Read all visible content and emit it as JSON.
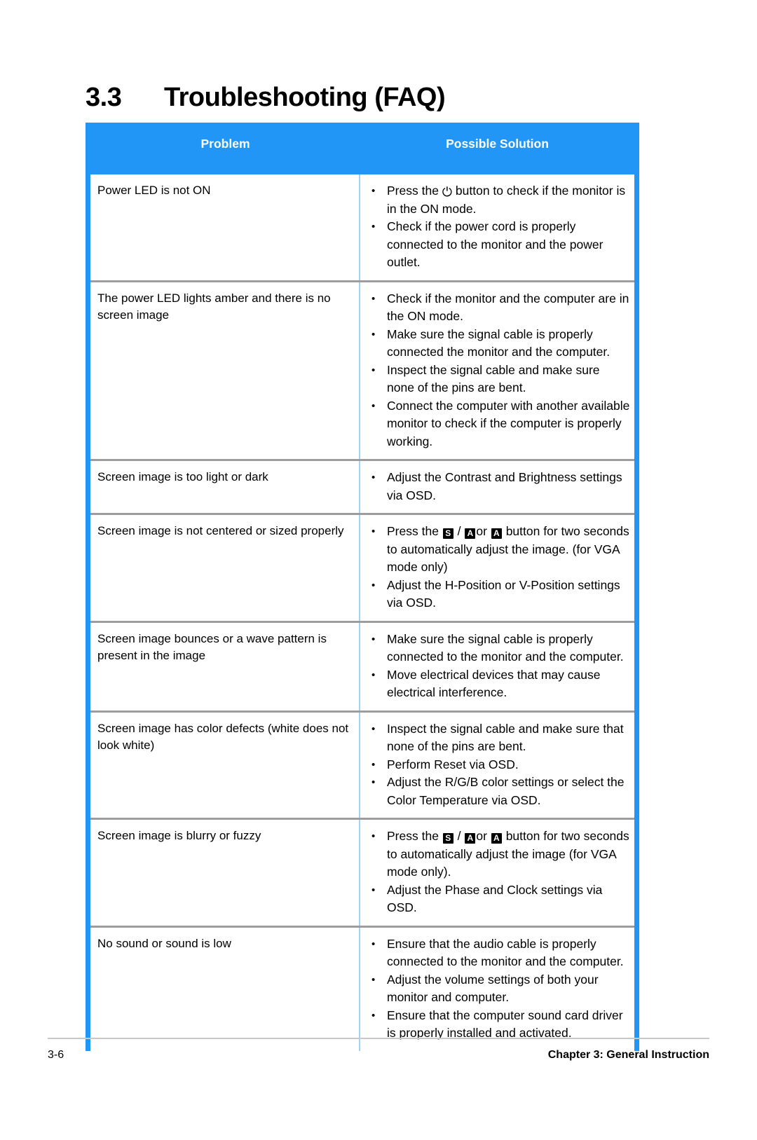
{
  "heading": {
    "number": "3.3",
    "title": "Troubleshooting (FAQ)"
  },
  "table": {
    "columns": {
      "problem": "Problem",
      "solution": "Possible Solution"
    },
    "rows": [
      {
        "problem": "Power  LED is not ON",
        "solutions": [
          {
            "parts": [
              {
                "type": "text",
                "value": "Press the "
              },
              {
                "type": "icon",
                "icon": "power-icon",
                "glyph": "⏻"
              },
              {
                "type": "text",
                "value": " button to check if the monitor is in the ON mode."
              }
            ]
          },
          {
            "parts": [
              {
                "type": "text",
                "value": "Check if the power cord is properly connected to the monitor and the power outlet."
              }
            ]
          }
        ]
      },
      {
        "problem": "The power LED lights amber and there is no screen image",
        "solutions": [
          {
            "parts": [
              {
                "type": "text",
                "value": "Check if the monitor and the computer are in the ON mode."
              }
            ]
          },
          {
            "parts": [
              {
                "type": "text",
                "value": "Make sure the signal cable is properly connected the monitor and the computer."
              }
            ]
          },
          {
            "parts": [
              {
                "type": "text",
                "value": "Inspect the signal cable and make sure none of the pins are bent."
              }
            ]
          },
          {
            "parts": [
              {
                "type": "text",
                "value": "Connect the computer with another available monitor to check if the computer is properly working."
              }
            ]
          }
        ]
      },
      {
        "problem": "Screen image is too light or dark",
        "solutions": [
          {
            "parts": [
              {
                "type": "text",
                "value": "Adjust the Contrast and Brightness settings via OSD."
              }
            ]
          }
        ]
      },
      {
        "problem": "Screen image is not centered or sized properly",
        "solutions": [
          {
            "parts": [
              {
                "type": "text",
                "value": "Press the "
              },
              {
                "type": "icon",
                "icon": "source-key-icon",
                "glyph": "S"
              },
              {
                "type": "text",
                "value": " / "
              },
              {
                "type": "icon",
                "icon": "auto-key-icon",
                "glyph": "A"
              },
              {
                "type": "text",
                "value": "or "
              },
              {
                "type": "icon",
                "icon": "auto-key-icon",
                "glyph": "A"
              },
              {
                "type": "text",
                "value": " button for two seconds to automatically adjust the image. (for VGA mode only)"
              }
            ]
          },
          {
            "parts": [
              {
                "type": "text",
                "value": "Adjust the H-Position or V-Position settings via OSD."
              }
            ]
          }
        ]
      },
      {
        "problem": "Screen image bounces or a wave pattern is present in the image",
        "solutions": [
          {
            "parts": [
              {
                "type": "text",
                "value": "Make sure the signal cable is properly connected to the monitor and the computer."
              }
            ]
          },
          {
            "parts": [
              {
                "type": "text",
                "value": "Move electrical devices that may cause electrical interference."
              }
            ]
          }
        ]
      },
      {
        "problem": "Screen image has color defects (white does not look white)",
        "solutions": [
          {
            "parts": [
              {
                "type": "text",
                "value": "Inspect the signal cable and make sure that none of the pins are bent."
              }
            ]
          },
          {
            "parts": [
              {
                "type": "text",
                "value": "Perform Reset via OSD."
              }
            ]
          },
          {
            "parts": [
              {
                "type": "text",
                "value": "Adjust the R/G/B color settings or select the Color Temperature via OSD."
              }
            ]
          }
        ]
      },
      {
        "problem": "Screen image is blurry or fuzzy",
        "solutions": [
          {
            "parts": [
              {
                "type": "text",
                "value": "Press the "
              },
              {
                "type": "icon",
                "icon": "source-key-icon",
                "glyph": "S"
              },
              {
                "type": "text",
                "value": " / "
              },
              {
                "type": "icon",
                "icon": "auto-key-icon",
                "glyph": "A"
              },
              {
                "type": "text",
                "value": "or "
              },
              {
                "type": "icon",
                "icon": "auto-key-icon",
                "glyph": "A"
              },
              {
                "type": "text",
                "value": " button for two seconds to automatically adjust the image (for VGA mode only)."
              }
            ]
          },
          {
            "parts": [
              {
                "type": "text",
                "value": "Adjust the Phase and Clock settings via OSD."
              }
            ]
          }
        ]
      },
      {
        "problem": "No sound or sound is low",
        "solutions": [
          {
            "parts": [
              {
                "type": "text",
                "value": "Ensure that the audio cable is properly connected to the monitor and the computer."
              }
            ]
          },
          {
            "parts": [
              {
                "type": "text",
                "value": "Adjust the volume settings of both your monitor and computer."
              }
            ]
          },
          {
            "parts": [
              {
                "type": "text",
                "value": "Ensure that the computer sound card driver is properly installed and activated."
              }
            ]
          }
        ]
      }
    ]
  },
  "footer": {
    "page_number": "3-6",
    "chapter": "Chapter 3: General Instruction"
  },
  "colors": {
    "accent_blue": "#2196f7",
    "row_divider": "#9d9d9d",
    "column_divider": "#9fd3f7",
    "footer_rule": "#c8c8c8"
  }
}
